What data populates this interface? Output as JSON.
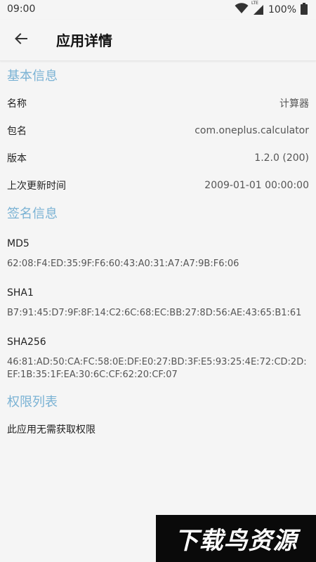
{
  "status_bar": {
    "time": "09:00",
    "network_label": "LTE",
    "battery": "100%",
    "icons": [
      "wifi-icon",
      "signal-icon",
      "battery-icon"
    ]
  },
  "app_bar": {
    "title": "应用详情",
    "back_icon": "arrow-left-icon"
  },
  "basic_info": {
    "header": "基本信息",
    "rows": [
      {
        "key": "名称",
        "value": "计算器"
      },
      {
        "key": "包名",
        "value": "com.oneplus.calculator"
      },
      {
        "key": "版本",
        "value": "1.2.0 (200)"
      },
      {
        "key": "上次更新时间",
        "value": "2009-01-01 00:00:00"
      }
    ]
  },
  "signature_info": {
    "header": "签名信息",
    "items": [
      {
        "label": "MD5",
        "value": "62:08:F4:ED:35:9F:F6:60:43:A0:31:A7:A7:9B:F6:06"
      },
      {
        "label": "SHA1",
        "value": "B7:91:45:D7:9F:8F:14:C2:6C:68:EC:BB:27:8D:56:AE:43:65:B1:61"
      },
      {
        "label": "SHA256",
        "value": "46:81:AD:50:CA:FC:58:0E:DF:E0:27:BD:3F:E5:93:25:4E:72:CD:2D:EF:1B:35:1F:EA:30:6C:CF:62:20:CF:07"
      }
    ]
  },
  "permissions": {
    "header": "权限列表",
    "text": "此应用无需获取权限"
  },
  "watermark": {
    "text": "下载鸟资源"
  },
  "colors": {
    "section_header": "#7ab2d4",
    "background": "#f5f5f5",
    "watermark_bg": "#0a0a0a"
  }
}
